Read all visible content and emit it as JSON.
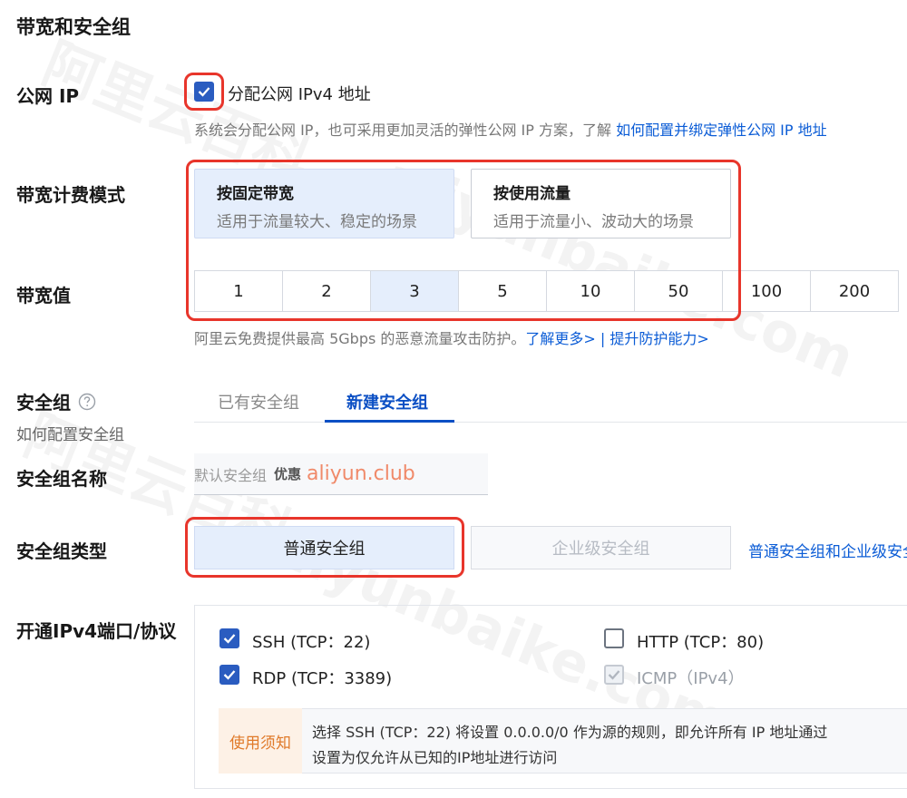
{
  "section_title": "带宽和安全组",
  "public_ip": {
    "label": "公网 IP",
    "checkbox_label": "分配公网 IPv4 地址",
    "checked": true,
    "hint": "系统会分配公网 IP，也可采用更加灵活的弹性公网 IP 方案，了解",
    "hint_link": "如何配置并绑定弹性公网 IP 地址"
  },
  "billing": {
    "label": "带宽计费模式",
    "options": [
      {
        "title": "按固定带宽",
        "desc": "适用于流量较大、稳定的场景",
        "selected": true
      },
      {
        "title": "按使用流量",
        "desc": "适用于流量小、波动大的场景",
        "selected": false
      }
    ]
  },
  "bandwidth": {
    "label": "带宽值",
    "values": [
      "1",
      "2",
      "3",
      "5",
      "10",
      "50",
      "100",
      "200"
    ],
    "selected": "3",
    "hint": "阿里云免费提供最高 5Gbps 的恶意流量攻击防护。",
    "link1": "了解更多>",
    "separator": "|",
    "link2": "提升防护能力>"
  },
  "security_group": {
    "label": "安全组",
    "help_icon": "question-circle-icon",
    "sub_label": "如何配置安全组",
    "tabs": [
      {
        "label": "已有安全组",
        "active": false
      },
      {
        "label": "新建安全组",
        "active": true
      }
    ]
  },
  "sg_name": {
    "label": "安全组名称",
    "placeholder": "默认安全组",
    "promo_prefix": "优惠",
    "promo_site": "aliyun.club"
  },
  "sg_type": {
    "label": "安全组类型",
    "options": [
      {
        "label": "普通安全组",
        "selected": true,
        "disabled": false
      },
      {
        "label": "企业级安全组",
        "selected": false,
        "disabled": true
      }
    ],
    "link": "普通安全组和企业级安全组"
  },
  "ports": {
    "label": "开通IPv4端口/协议",
    "items": [
      {
        "label": "SSH (TCP：22)",
        "checked": true,
        "disabled": false
      },
      {
        "label": "HTTP (TCP：80)",
        "checked": false,
        "disabled": false
      },
      {
        "label": "RDP (TCP：3389)",
        "checked": true,
        "disabled": false
      },
      {
        "label": "ICMP（IPv4）",
        "checked": true,
        "disabled": true
      }
    ],
    "notice_title": "使用须知",
    "notice_line1": "选择 SSH (TCP：22) 将设置 0.0.0.0/0 作为源的规则，即允许所有 IP 地址通过",
    "notice_line2": "设置为仅允许从已知的IP地址进行访问"
  },
  "watermark": {
    "cn": "阿里云百科",
    "en": "aliyunbaike.com"
  },
  "colors": {
    "accent": "#2a5cc0",
    "link": "#0b5cd6",
    "highlight": "#e8352b",
    "selected_bg": "#e5eefc",
    "promo": "#f08a6a"
  }
}
